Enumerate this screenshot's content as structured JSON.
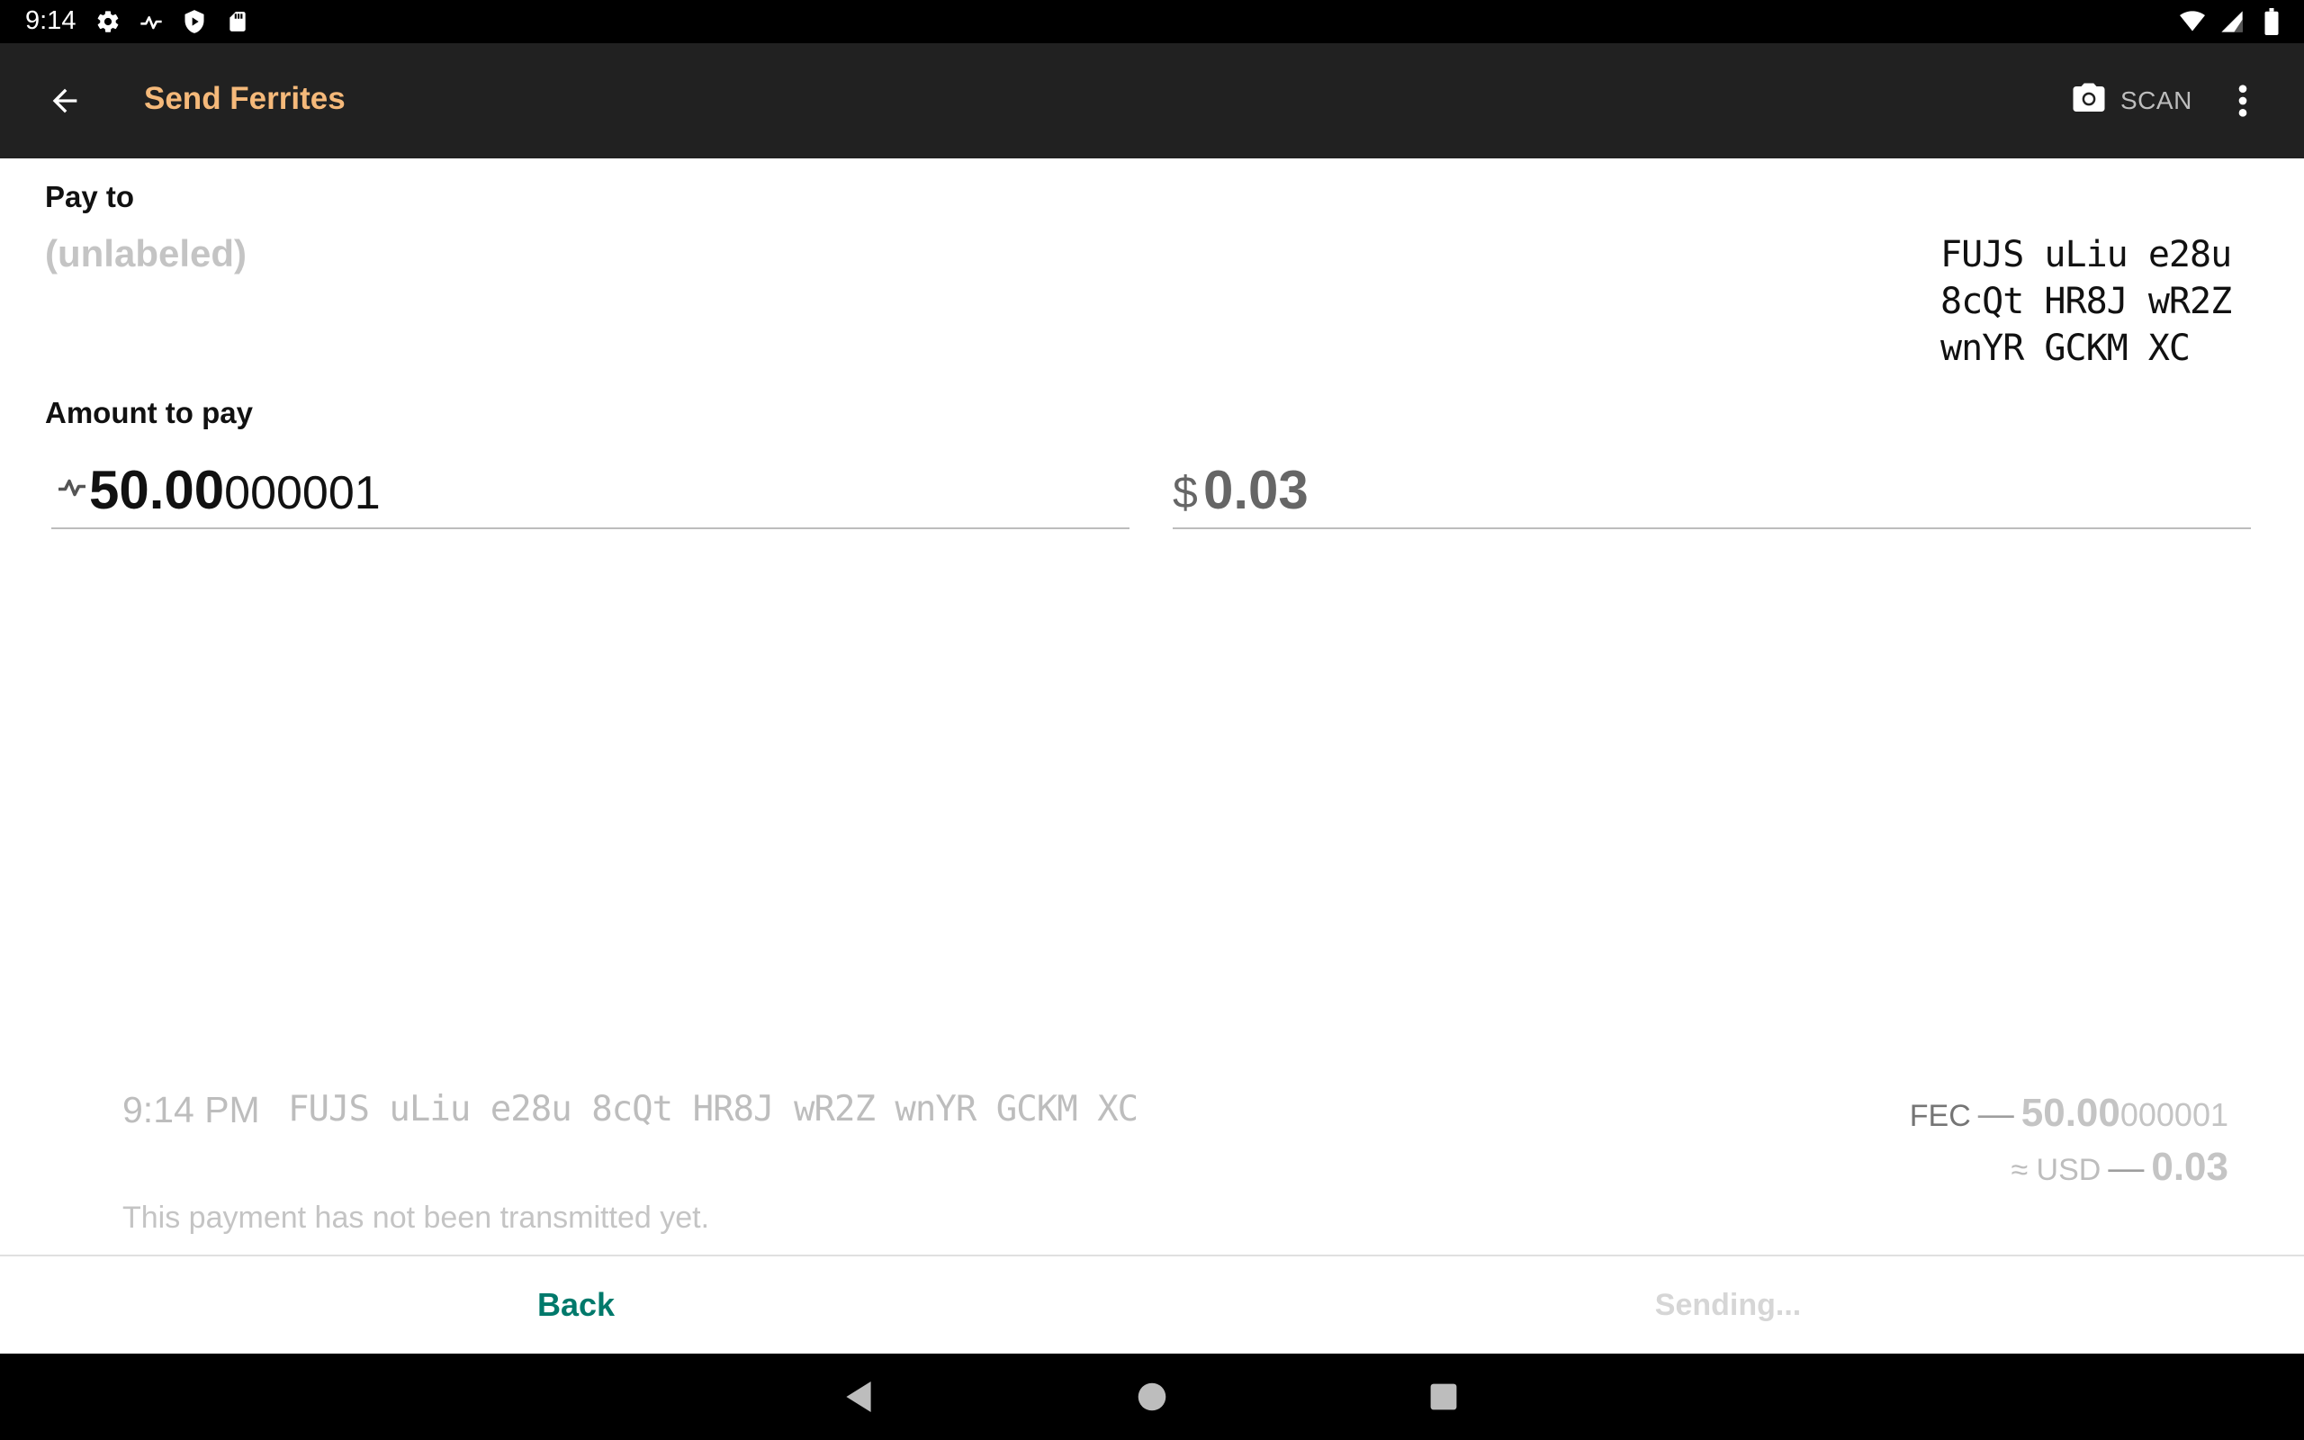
{
  "status_bar": {
    "time": "9:14",
    "icons_left": [
      "settings-icon",
      "ferrite-icon",
      "shield-icon",
      "sd-card-icon"
    ],
    "icons_right": [
      "wifi-icon",
      "signal-icon",
      "battery-icon"
    ]
  },
  "app_bar": {
    "title": "Send Ferrites",
    "scan_label": "SCAN",
    "back_icon": "arrow-back-icon",
    "camera_icon": "camera-icon",
    "menu_icon": "more-vert-icon",
    "title_color": "#f5b97a",
    "background": "#212121"
  },
  "pay_to": {
    "label": "Pay to",
    "recipient_label": "(unlabeled)",
    "address_lines": [
      "FUJS uLiu e28u",
      "8cQt HR8J wR2Z",
      "wnYR GCKM XC"
    ]
  },
  "amount": {
    "label": "Amount to pay",
    "coin_value_main": "50.00",
    "coin_value_precision": "000001",
    "fiat_symbol": "$",
    "fiat_value": "0.03"
  },
  "transaction": {
    "time": "9:14 PM",
    "address": "FUJS uLiu e28u 8cQt HR8J wR2Z wnYR GCKM XC",
    "currency": "FEC",
    "sign": "—",
    "amount_main": "50.00",
    "amount_precision": "000001",
    "fiat_label": "≈ USD",
    "fiat_value": "0.03",
    "note": "This payment has not been transmitted yet."
  },
  "actions": {
    "back_label": "Back",
    "sending_label": "Sending...",
    "accent_color": "#00796b"
  },
  "nav_bar": {
    "icons": [
      "nav-back-icon",
      "nav-home-icon",
      "nav-recents-icon"
    ]
  }
}
